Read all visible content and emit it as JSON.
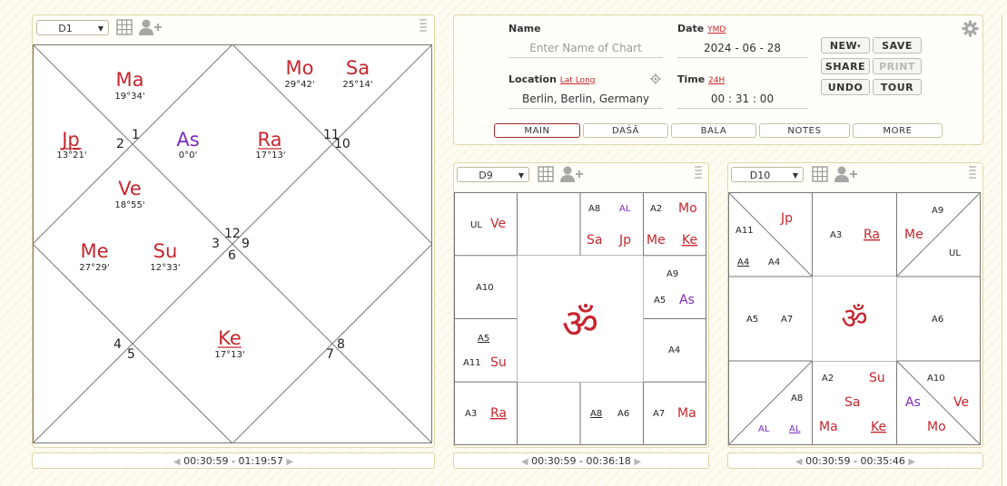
{
  "d1": {
    "chart_select": "D1",
    "time_range": "00:30:59 - 01:19:57",
    "planets": [
      {
        "name": "Ma",
        "deg": "19°34'",
        "color": "red"
      },
      {
        "name": "Mo",
        "deg": "29°42'",
        "color": "red"
      },
      {
        "name": "Sa",
        "deg": "25°14'",
        "color": "red"
      },
      {
        "name": "Jp",
        "deg": "13°21'",
        "color": "red",
        "underline": true
      },
      {
        "name": "As",
        "deg": "0°0'",
        "color": "purple"
      },
      {
        "name": "Ra",
        "deg": "17°13'",
        "color": "red",
        "underline": true
      },
      {
        "name": "Ve",
        "deg": "18°55'",
        "color": "red"
      },
      {
        "name": "Me",
        "deg": "27°29'",
        "color": "red"
      },
      {
        "name": "Su",
        "deg": "12°33'",
        "color": "red"
      },
      {
        "name": "Ke",
        "deg": "17°13'",
        "color": "red",
        "underline": true
      }
    ],
    "house_numbers": [
      "1",
      "2",
      "11",
      "10",
      "12",
      "3",
      "9",
      "6",
      "4",
      "5",
      "8",
      "7"
    ]
  },
  "form": {
    "name_label": "Name",
    "name_placeholder": "Enter Name of Chart",
    "date_label": "Date",
    "date_format_link": "YMD",
    "date_value": "2024 - 06 - 28",
    "location_label": "Location",
    "latlong_link": "Lat Long",
    "location_value": "Berlin, Berlin, Germany",
    "time_label": "Time",
    "time_format_link": "24H",
    "time_value": "00 : 31 : 00",
    "buttons": {
      "new": "NEW",
      "save": "SAVE",
      "share": "SHARE",
      "print": "PRINT",
      "undo": "UNDO",
      "tour": "TOUR"
    },
    "tabs": [
      "MAIN",
      "DAŚĀ",
      "BALA",
      "NOTES",
      "MORE"
    ]
  },
  "d9": {
    "chart_select": "D9",
    "time_range": "00:30:59 - 00:36:18",
    "om": "ॐ",
    "cells": {
      "r1c1": {
        "items": [
          "UL",
          "Ve"
        ]
      },
      "r1c3": {
        "top": [
          "A8",
          "AL"
        ],
        "bottom": [
          "Sa",
          "Jp"
        ]
      },
      "r1c4": {
        "top": [
          "A2",
          "Mo"
        ],
        "bottom": [
          "Me",
          "Ke"
        ]
      },
      "r2c1": {
        "items": [
          "A10"
        ]
      },
      "r2c4": {
        "top": [
          "A9"
        ],
        "bottom": [
          "A5",
          "As"
        ]
      },
      "r3c1": {
        "top": [
          "A5"
        ],
        "bottom": [
          "A11",
          "Su"
        ]
      },
      "r3c4": {
        "items": [
          "A4"
        ]
      },
      "r4c1": {
        "items": [
          "A3",
          "Ra"
        ]
      },
      "r4c3": {
        "items": [
          "A8",
          "A6"
        ]
      },
      "r4c4": {
        "items": [
          "A7",
          "Ma"
        ]
      }
    }
  },
  "d10": {
    "chart_select": "D10",
    "time_range": "00:30:59 - 00:35:46",
    "om": "ॐ",
    "cells": {
      "tl_upper": [
        "Jp"
      ],
      "tl_lower": [
        "A11",
        "A4",
        "A4"
      ],
      "t2": [
        "A3",
        "Ra"
      ],
      "tr_upper": [
        "A9",
        "UL"
      ],
      "tr_lower": [
        "Me"
      ],
      "m1": [
        "A5",
        "A7"
      ],
      "m4": [
        "A6"
      ],
      "bl_upper": [
        "A8"
      ],
      "bl_lower": [
        "AL",
        "AL"
      ],
      "b2": [
        "A2",
        "Su",
        "Sa",
        "Ma",
        "Ke"
      ],
      "br": [
        "A10",
        "As",
        "Ve",
        "Mo"
      ]
    }
  },
  "colors": {
    "red": "#c6262e",
    "purple": "#7a2bbf",
    "border": "#e3d7a6"
  }
}
